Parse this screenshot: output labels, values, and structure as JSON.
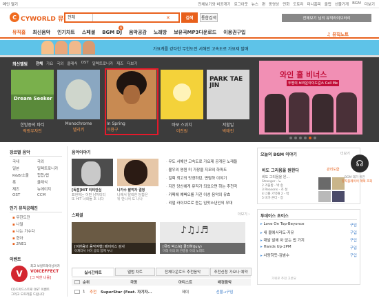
{
  "topbar": {
    "left_text": "메인 열기",
    "links": [
      "전체보기와 비공개기",
      "로그아웃",
      "뉴스",
      "편",
      "동영상",
      "만화",
      "도토리",
      "미니홈피",
      "클럽",
      "선물가게",
      "BGM",
      "더보기"
    ]
  },
  "logo": {
    "text": "CYWORLD 뮤직"
  },
  "search": {
    "category": "전체",
    "button": "검색",
    "detail_button": "통합검색"
  },
  "header_right": {
    "text": "전체보기 님의 뮤직라이브러리"
  },
  "nav": {
    "items": [
      "뮤직홈",
      "최신음악",
      "인기차트",
      "스페셜",
      "BGM DJ",
      "음악공감",
      "노래방",
      "보유곡MP3다운로드",
      "이용권구입"
    ],
    "right": "뮤직노트",
    "badge": "N"
  },
  "banner": {
    "text": "가요계를 강타한 무한도전 서해안 고속도로 가요제 발매"
  },
  "latest": {
    "title": "최신앨범",
    "tabs": [
      "전체",
      "가요",
      "국외",
      "클래식",
      "OST",
      "일렉트로니카",
      "재즈",
      "더보기"
    ],
    "albums": [
      {
        "label": "Dream Seeker",
        "line1": "한밤중의 파티",
        "line2": "락랑우자인"
      },
      {
        "label": "",
        "line1": "Monochrome",
        "line2": "델리키"
      },
      {
        "label": "",
        "line1": "In Spring",
        "line2": "이용구"
      },
      {
        "label": "",
        "line1": "바보 스위치",
        "line2": "이진원"
      },
      {
        "label": "PARK TAE JIN",
        "line1": "저할일",
        "line2": "박태진"
      }
    ],
    "promo": {
      "title": "와인 홀 비너스",
      "subtitle": "두명의 브라운아이드걸스 Call Me"
    }
  },
  "genres": {
    "title": "장르별 음악",
    "cols": [
      [
        "국내",
        "일본",
        "R&B/소울",
        "록",
        "재즈",
        "OST"
      ],
      [
        "국외",
        "일렉트로니카",
        "힙합/랩",
        "클래식",
        "뉴에이지",
        "CCM"
      ]
    ]
  },
  "popular": {
    "title": "인기 뮤직공해진",
    "items": [
      "무한도전",
      "나얼",
      "나는 가수다",
      "현아",
      "2NE1"
    ]
  },
  "event": {
    "title": "이벤트",
    "text1": "최고 보컬트레이닝아카",
    "brand": "VOICEFFECT",
    "text2": "[그 작한 너를]",
    "text3": "CD드마드스트로 OST 이벤트",
    "text4": "그리고 도토리를 드립니다"
  },
  "interview": {
    "title": "음악이야기",
    "items": [
      {
        "cap1": "[독점]HIT 티티안심",
        "cap2": "표현하는 어떤 남자티티",
        "cap3": "또 HIT 너희들 조 니다"
      },
      {
        "cap1": "나가수 팔먹자 결정",
        "cap2": "나에서 탈락한 당함은",
        "cap3": "위 만나서 도 나나"
      }
    ]
  },
  "news": {
    "items": [
      "무도 서해안 고속도로 가요제 공개된 노래들",
      "볼우의 영원 미 가장을 지모의 하파도",
      "일렉 최고의 맛경하던, 면탐하 이야기",
      "지킨 당신에게 뮤직가 되었으면 하는 추천곡",
      "카페에 예뻐오를 거진 이성 음악의 유효",
      "리얼 라이브로로 듣는 입맛소년인의 무대"
    ]
  },
  "special": {
    "title": "스페셜",
    "items": [
      {
        "cap": "[이현음의 음악여행] 베이이스 감사",
        "cap2": "아재라서 아이 음악 함께 누나"
      },
      {
        "cap": "[뮤직 박스북] 쿨라하(Juiy)",
        "cap2": "미래 이의 화 관중을 이의 노래도"
      }
    ]
  },
  "bottom_tabs": [
    "실시간차트",
    "앨범 차트",
    "전체다운로드 추천음악",
    "추천신청 가요나 예약"
  ],
  "table": {
    "headers": [
      "순위",
      "곡명",
      "아티스트",
      "배경음악"
    ],
    "row": {
      "rank": "1",
      "badge": "추천",
      "title": "SuperStar (Feat. 자기자...",
      "artist": "제이",
      "action": "선물→구입"
    }
  },
  "bgm": {
    "title": "오늘의 BGM 이야기",
    "more": "더보기",
    "headline": "비도 그리움을 원한다",
    "sub": "관리도함",
    "tab": "비도 그리움을 원...",
    "list": [
      "Stronger - 노",
      "2 겨울밤 - 박 송",
      "3 Reasons - 조 성",
      "4 너를 기억해 2 - 박",
      "5 비가 온다 - 장"
    ],
    "list_label": "BGM 영동"
  },
  "buy": {
    "title": "투데이스 초이스",
    "items": [
      {
        "t": "Love On Top-Beyonce",
        "a": "구입"
      },
      {
        "t": "내 물에서라도-지유",
        "a": "구입"
      },
      {
        "t": "대발 발에 차 없는 법 가지",
        "a": "구입"
      },
      {
        "t": "Hands Up-2PM",
        "a": "구입"
      },
      {
        "t": "사랑하듯-김범수",
        "a": "구입"
      }
    ],
    "note": "가위로 추천 고른요"
  },
  "right_promo": {
    "line1": "BGM 돼가 위한",
    "line2": "뮤직플레이어 혜택 조회"
  }
}
